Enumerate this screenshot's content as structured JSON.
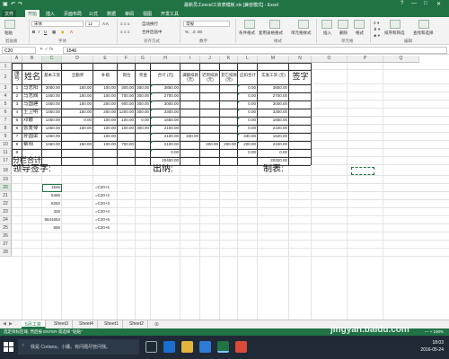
{
  "window": {
    "title": "最新员工excel工资表模板.xls [兼容模式] - Excel",
    "controls": [
      "?",
      "—",
      "□",
      "✕"
    ]
  },
  "tabs": [
    "文件",
    "开始",
    "插入",
    "页面布局",
    "公式",
    "数据",
    "审阅",
    "视图",
    "开发工具"
  ],
  "ribbon": {
    "paste_label": "粘贴",
    "font_name": "宋体",
    "font_size": "12",
    "groups": [
      "剪贴板",
      "字体",
      "对齐方式",
      "数字",
      "样式",
      "单元格",
      "编辑"
    ],
    "wrap_text": "自动换行",
    "merge_center": "合并后居中",
    "number_format": "常规",
    "cond_format": "条件格式",
    "table_format": "套用表格格式",
    "cell_style": "单元格样式",
    "insert": "插入",
    "delete": "删除",
    "format": "格式",
    "sort_filter": "排序和筛选",
    "find_select": "查找和选择"
  },
  "formula_bar": {
    "name_box": "C20",
    "icons": "✕ ✓ fx",
    "formula": "1546"
  },
  "columns": [
    "A",
    "B",
    "C",
    "D",
    "E",
    "F",
    "G",
    "H",
    "I",
    "J",
    "K",
    "L",
    "M",
    "N",
    "O",
    "P",
    "Q"
  ],
  "rows": [
    "1",
    "2",
    "3",
    "4",
    "5",
    "6",
    "7",
    "8",
    "9",
    "10",
    "11",
    "17",
    "18",
    "19",
    "20",
    "21",
    "22",
    "23",
    "24",
    "25",
    "26",
    "27",
    "28"
  ],
  "table": {
    "headers": [
      "序号",
      "姓名",
      "基本工资",
      "全勤奖",
      "补助",
      "岗位",
      "奖金",
      "合计 (元)",
      "满额扣款 (元)",
      "迟到扣款 (元)",
      "其它扣款 (元)",
      "应扣合计",
      "实发工资 (元)",
      "签字"
    ],
    "people": [
      {
        "id": "1",
        "name": "马志阳",
        "vals": [
          "3000.00",
          "150.00",
          "100.00",
          "300.00",
          "300.00",
          "3850.00",
          "",
          "",
          "",
          "0.00",
          "3850.00"
        ]
      },
      {
        "id": "2",
        "name": "马志阀",
        "vals": [
          "1450.00",
          "150.00",
          "100.00",
          "700.00",
          "300.00",
          "2700.00",
          "",
          "",
          "",
          "0.00",
          "2700.00"
        ]
      },
      {
        "id": "3",
        "name": "马国建",
        "vals": [
          "1450.00",
          "150.00",
          "200.00",
          "900.00",
          "300.00",
          "3000.00",
          "",
          "",
          "",
          "0.00",
          "3000.00"
        ]
      },
      {
        "id": "4",
        "name": "王卫明",
        "vals": [
          "1450.00",
          "150.00",
          "200.00",
          "1200.00",
          "300.00",
          "3300.00",
          "",
          "",
          "",
          "0.00",
          "3300.00"
        ]
      },
      {
        "id": "5",
        "name": "邓娜",
        "vals": [
          "1450.00",
          "0.00",
          "100.00",
          "100.00",
          "0.00",
          "1650.00",
          "",
          "",
          "",
          "0.00",
          "1650.00"
        ]
      },
      {
        "id": "6",
        "name": "张爱琴",
        "vals": [
          "1450.00",
          "150.00",
          "100.00",
          "100.00",
          "300.00",
          "2100.00",
          "",
          "",
          "",
          "0.00",
          "2100.00"
        ]
      },
      {
        "id": "7",
        "name": "孙国荣",
        "vals": [
          "1450.00",
          "",
          "100.00",
          "",
          "",
          "2100.00",
          "330.00",
          "",
          "",
          "330.00",
          "1620.00"
        ]
      },
      {
        "id": "8",
        "name": "蔡阳",
        "vals": [
          "1450.00",
          "150.00",
          "100.00",
          "700.00",
          "",
          "2100.00",
          "",
          "200.00",
          "200.00",
          "200.00",
          "2100.00"
        ]
      }
    ],
    "empty_rows": [
      {
        "id": "9",
        "h": "0.00",
        "l": "0.00",
        "m": "0.00"
      },
      {
        "id": "10",
        "h": "0.00",
        "l": "0.00",
        "m": "0.00"
      },
      {
        "id": "11",
        "h": "0.00",
        "l": "0.00",
        "m": "0.00"
      }
    ],
    "subtotal_label": "分栏合计",
    "subtotal_total": "20450.00",
    "subtotal_net": "20320.00"
  },
  "signatures": {
    "leader": "领导签字:",
    "cashier": "出纳:",
    "preparer": "制表:"
  },
  "calc": [
    {
      "value": "1546",
      "formula": "=C20+1"
    },
    {
      "value": "5465",
      "formula": "=C20+2"
    },
    {
      "value": "6262",
      "formula": "=C20+3"
    },
    {
      "value": "326",
      "formula": "=C20+4"
    },
    {
      "value": "5641654",
      "formula": "=C20+5"
    },
    {
      "value": "656",
      "formula": "=C20+6"
    }
  ],
  "sheets": [
    "5月工资",
    "Sheet3",
    "Sheet4",
    "Sheet1",
    "Sheet2"
  ],
  "status": {
    "left": "选定目标区域, 然后按 ENTER 或选择 \"粘贴\"",
    "right": "—  +  100%"
  },
  "taskbar": {
    "search": "我是 Cortana，小娜。有问题尽管问我。",
    "time": "18:03",
    "date": "2016-05-24",
    "watermark": "jingyan.baidu.com"
  },
  "colors": {
    "excel_green": "#217346",
    "taskbar": "#1f2a36"
  }
}
